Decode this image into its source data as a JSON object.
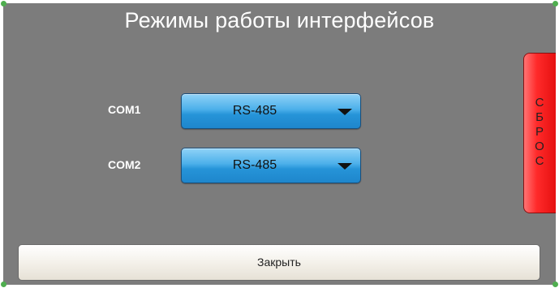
{
  "dialog": {
    "title": "Режимы работы интерфейсов"
  },
  "ports": [
    {
      "label": "COM1",
      "mode": "RS-485"
    },
    {
      "label": "COM2",
      "mode": "RS-485"
    }
  ],
  "reset_button": {
    "label": "СБРОС",
    "letters": [
      "С",
      "Б",
      "Р",
      "О",
      "С"
    ],
    "color": "#ff2a2a"
  },
  "close_button": {
    "label": "Закрыть"
  },
  "icons": {
    "dropdown_arrow": "caret-down-icon"
  },
  "colors": {
    "panel_background": "#7c7c7c",
    "dropdown_blue": "#2694d8",
    "corner_marker": "#4fae4f"
  }
}
